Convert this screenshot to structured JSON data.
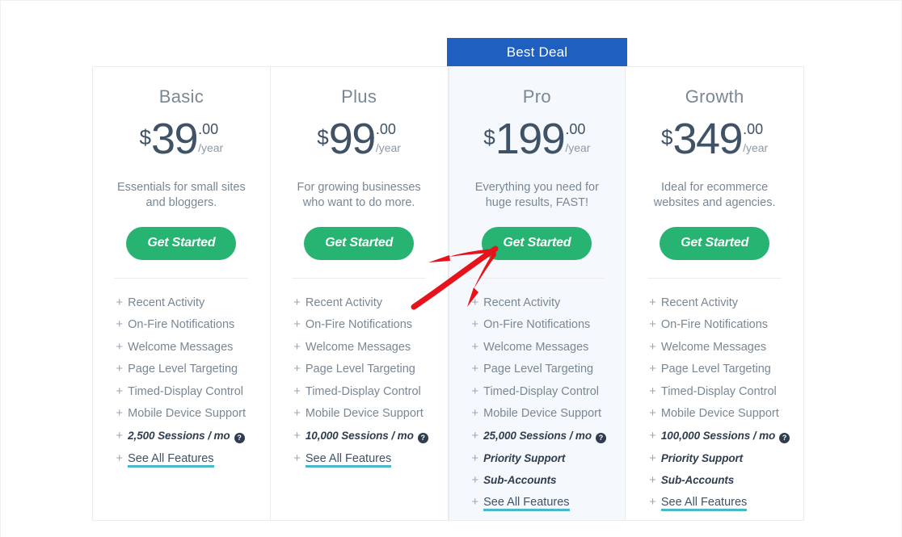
{
  "banner": {
    "label": "Best Deal",
    "color": "#1f5fbf"
  },
  "colors": {
    "cta_green": "#27b372",
    "price_slate": "#3f5266",
    "muted": "#7a8794",
    "featured_bg": "#f5f8fd",
    "link_underline": "#4ab8c9",
    "annotation_red": "#e8121b"
  },
  "plans": [
    {
      "name": "Basic",
      "currency": "$",
      "amount": "39",
      "cents": ".00",
      "period": "/year",
      "description": "Essentials for small sites and bloggers.",
      "cta": "Get Started",
      "features": [
        {
          "label": "Recent Activity",
          "style": "normal",
          "help": false
        },
        {
          "label": "On-Fire Notifications",
          "style": "normal",
          "help": false
        },
        {
          "label": "Welcome Messages",
          "style": "normal",
          "help": false
        },
        {
          "label": "Page Level Targeting",
          "style": "normal",
          "help": false
        },
        {
          "label": "Timed-Display Control",
          "style": "normal",
          "help": false
        },
        {
          "label": "Mobile Device Support",
          "style": "normal",
          "help": false
        },
        {
          "label": "2,500 Sessions / mo",
          "style": "strong",
          "help": true
        },
        {
          "label": "See All Features",
          "style": "link",
          "help": false
        }
      ]
    },
    {
      "name": "Plus",
      "currency": "$",
      "amount": "99",
      "cents": ".00",
      "period": "/year",
      "description": "For growing businesses who want to do more.",
      "cta": "Get Started",
      "features": [
        {
          "label": "Recent Activity",
          "style": "normal",
          "help": false
        },
        {
          "label": "On-Fire Notifications",
          "style": "normal",
          "help": false
        },
        {
          "label": "Welcome Messages",
          "style": "normal",
          "help": false
        },
        {
          "label": "Page Level Targeting",
          "style": "normal",
          "help": false
        },
        {
          "label": "Timed-Display Control",
          "style": "normal",
          "help": false
        },
        {
          "label": "Mobile Device Support",
          "style": "normal",
          "help": false
        },
        {
          "label": "10,000 Sessions / mo",
          "style": "strong",
          "help": true
        },
        {
          "label": "See All Features",
          "style": "link",
          "help": false
        }
      ]
    },
    {
      "name": "Pro",
      "currency": "$",
      "amount": "199",
      "cents": ".00",
      "period": "/year",
      "description": "Everything you need for huge results, FAST!",
      "cta": "Get Started",
      "featured": true,
      "features": [
        {
          "label": "Recent Activity",
          "style": "normal",
          "help": false
        },
        {
          "label": "On-Fire Notifications",
          "style": "normal",
          "help": false
        },
        {
          "label": "Welcome Messages",
          "style": "normal",
          "help": false
        },
        {
          "label": "Page Level Targeting",
          "style": "normal",
          "help": false
        },
        {
          "label": "Timed-Display Control",
          "style": "normal",
          "help": false
        },
        {
          "label": "Mobile Device Support",
          "style": "normal",
          "help": false
        },
        {
          "label": "25,000 Sessions / mo",
          "style": "strong",
          "help": true
        },
        {
          "label": "Priority Support",
          "style": "strong",
          "help": false
        },
        {
          "label": "Sub-Accounts",
          "style": "strong",
          "help": false
        },
        {
          "label": "See All Features",
          "style": "link",
          "help": false
        }
      ]
    },
    {
      "name": "Growth",
      "currency": "$",
      "amount": "349",
      "cents": ".00",
      "period": "/year",
      "description": "Ideal for ecommerce websites and agencies.",
      "cta": "Get Started",
      "features": [
        {
          "label": "Recent Activity",
          "style": "normal",
          "help": false
        },
        {
          "label": "On-Fire Notifications",
          "style": "normal",
          "help": false
        },
        {
          "label": "Welcome Messages",
          "style": "normal",
          "help": false
        },
        {
          "label": "Page Level Targeting",
          "style": "normal",
          "help": false
        },
        {
          "label": "Timed-Display Control",
          "style": "normal",
          "help": false
        },
        {
          "label": "Mobile Device Support",
          "style": "normal",
          "help": false
        },
        {
          "label": "100,000 Sessions / mo",
          "style": "strong",
          "help": true
        },
        {
          "label": "Priority Support",
          "style": "strong",
          "help": false
        },
        {
          "label": "Sub-Accounts",
          "style": "strong",
          "help": false
        },
        {
          "label": "See All Features",
          "style": "link",
          "help": false
        }
      ]
    }
  ],
  "annotation": {
    "type": "hand-drawn-arrow",
    "points_to": "Get Started (Pro)",
    "color": "#e8121b"
  },
  "icons": {
    "help": "?",
    "plus": "+"
  }
}
